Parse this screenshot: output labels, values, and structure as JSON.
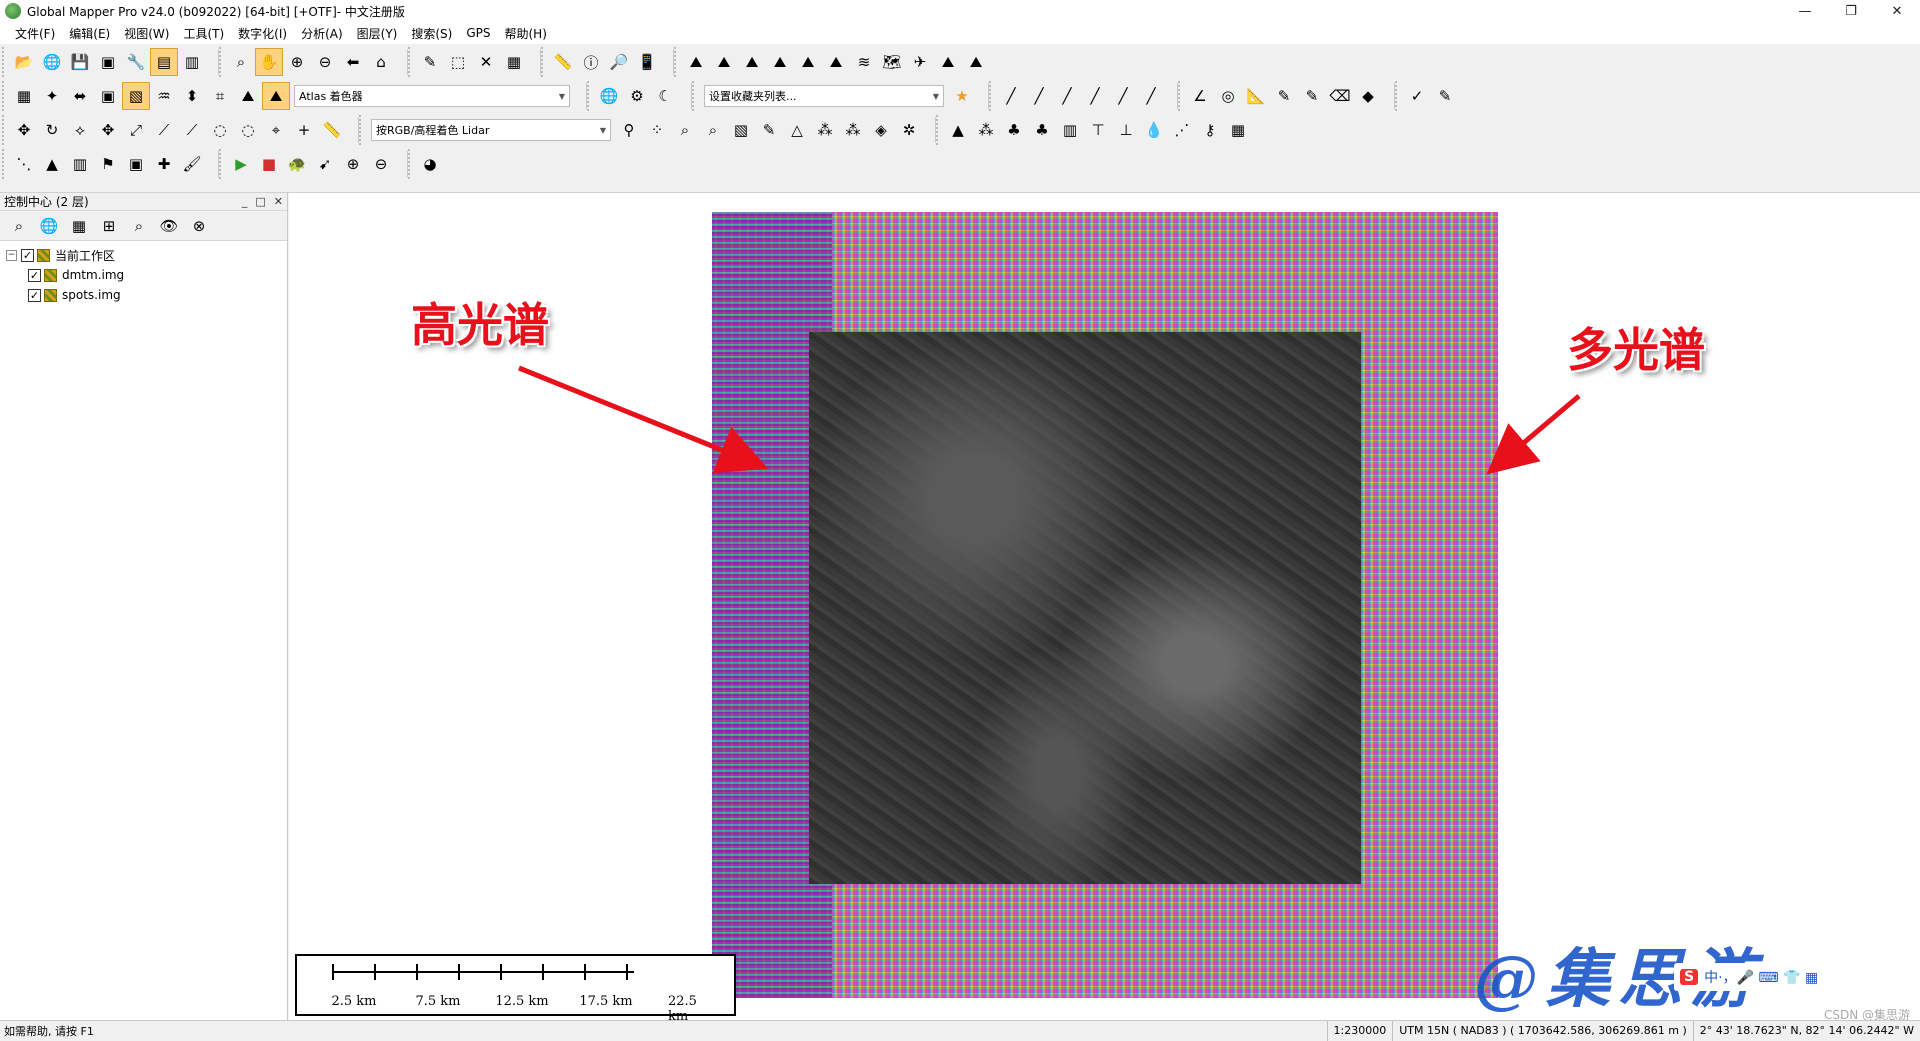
{
  "window": {
    "title": "Global Mapper Pro v24.0 (b092022) [64-bit] [+OTF]- 中文注册版",
    "controls": [
      "—",
      "❐",
      "✕"
    ]
  },
  "menu": [
    "文件(F)",
    "编辑(E)",
    "视图(W)",
    "工具(T)",
    "数字化(I)",
    "分析(A)",
    "图层(Y)",
    "搜索(S)",
    "GPS",
    "帮助(H)"
  ],
  "toolbar": {
    "shader_combo": "Atlas 着色器",
    "favorites_combo": "设置收藏夹列表...",
    "lidar_combo": "按RGB/高程着色 Lidar"
  },
  "control_center": {
    "title": "控制中心 (2 层)",
    "root_label": "当前工作区",
    "layers": [
      "dmtm.img",
      "spots.img"
    ]
  },
  "map": {
    "label_left": "高光谱",
    "label_right": "多光谱",
    "scale_labels": [
      "2.5 km",
      "7.5 km",
      "12.5 km",
      "17.5 km",
      "22.5 km"
    ],
    "watermark": "@集思游",
    "ime_text": "中·，🎤 ⌨ 👕 ▦"
  },
  "status": {
    "help": "如需帮助, 请按 F1",
    "scale": "1:230000",
    "projection": "UTM 15N ( NAD83 ) ( 1703642.586, 306269.861 m )",
    "coords": "2° 43' 18.7623\" N, 82° 14' 06.2442\" W",
    "credit": "CSDN @集思游"
  }
}
